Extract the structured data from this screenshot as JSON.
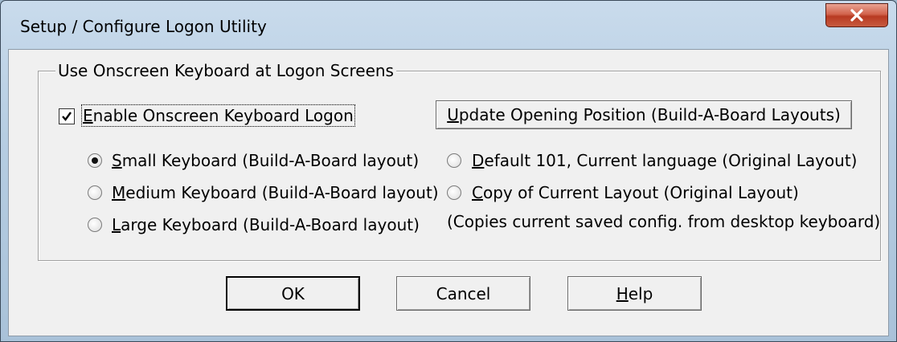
{
  "window": {
    "title": "Setup / Configure Logon Utility",
    "close_glyph": "x"
  },
  "group": {
    "legend": "Use Onscreen Keyboard at Logon Screens"
  },
  "enable_checkbox": {
    "label_mnemonic": "E",
    "label_rest": "nable Onscreen Keyboard Logon",
    "checked": true
  },
  "update_button": {
    "label_mnemonic": "U",
    "label_rest": "pdate Opening Position (Build-A-Board Layouts)"
  },
  "options_left": [
    {
      "mnemonic": "S",
      "rest": "mall Keyboard (Build-A-Board layout)",
      "selected": true
    },
    {
      "mnemonic": "M",
      "rest": "edium Keyboard (Build-A-Board layout)",
      "selected": false
    },
    {
      "mnemonic": "L",
      "rest": "arge Keyboard (Build-A-Board layout)",
      "selected": false
    }
  ],
  "options_right": [
    {
      "mnemonic": "D",
      "rest": "efault 101, Current language (Original Layout)",
      "selected": false
    },
    {
      "mnemonic": "C",
      "rest": "opy of Current Layout (Original Layout)",
      "selected": false
    }
  ],
  "note": "(Copies current saved config. from desktop keyboard)",
  "buttons": {
    "ok": "OK",
    "cancel": "Cancel",
    "help_mnemonic": "H",
    "help_rest": "elp"
  }
}
